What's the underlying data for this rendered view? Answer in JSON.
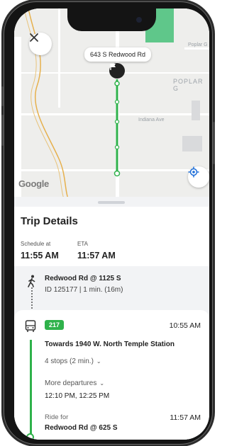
{
  "map": {
    "marker_label": "643 S Redwood Rd",
    "labels": {
      "area": "POPLAR G",
      "street": "Indiana Ave",
      "top_right": "Poplar G"
    },
    "attribution": "Google",
    "route_color": "#2fb24b"
  },
  "trip": {
    "title": "Trip Details",
    "schedule_label": "Schedule at",
    "schedule_time": "11:55 AM",
    "eta_label": "ETA",
    "eta_time": "11:57 AM"
  },
  "walk": {
    "stop": "Redwood Rd @ 1125 S",
    "id_info": "ID 125177 | 1 min. (16m)"
  },
  "route": {
    "number": "217",
    "depart_time": "10:55 AM",
    "towards": "Towards 1940 W. North Temple Station",
    "stops": "4 stops (2 min.)",
    "more_departures": "More departures",
    "departure_times": "12:10 PM, 12:25 PM",
    "ride_for": "Ride for",
    "arrive_time": "11:57 AM",
    "ride_stop": "Redwood Rd @ 625 S"
  },
  "icons": [
    "close-icon",
    "flag-icon",
    "locate-icon",
    "walk-icon",
    "bus-icon",
    "chevron-down-icon"
  ]
}
